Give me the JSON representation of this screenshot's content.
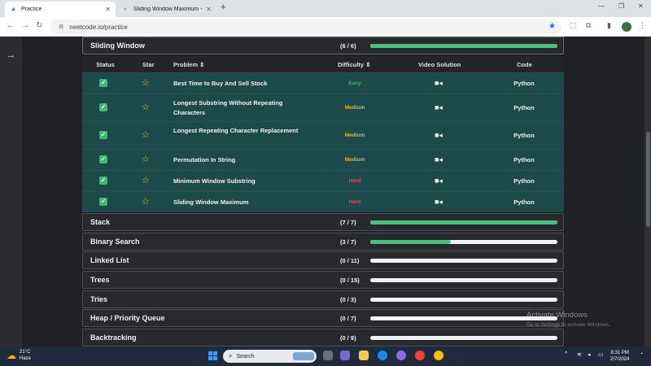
{
  "browser": {
    "tabs": [
      {
        "title": "Practice",
        "favicon": "neetcode-icon",
        "active": true
      },
      {
        "title": "Sliding Window Maximum - Le",
        "favicon": "leetcode-icon",
        "active": false
      }
    ],
    "url": "neetcode.io/practice"
  },
  "table": {
    "headers": {
      "status": "Status",
      "star": "Star",
      "problem": "Problem",
      "difficulty": "Difficulty",
      "video": "Video Solution",
      "code": "Code"
    },
    "difficulty_colors": {
      "Easy": "#3dba70",
      "Medium": "#f2b51d",
      "Hard": "#e04a5a"
    }
  },
  "sections": [
    {
      "name": "Sliding Window",
      "count": "(6 / 6)",
      "progress": 1.0
    },
    {
      "name": "Stack",
      "count": "(7 / 7)",
      "progress": 1.0
    },
    {
      "name": "Binary Search",
      "count": "(3 / 7)",
      "progress": 0.4286
    },
    {
      "name": "Linked List",
      "count": "(0 / 11)",
      "progress": 0
    },
    {
      "name": "Trees",
      "count": "(0 / 15)",
      "progress": 0
    },
    {
      "name": "Tries",
      "count": "(0 / 3)",
      "progress": 0
    },
    {
      "name": "Heap / Priority Queue",
      "count": "(0 / 7)",
      "progress": 0
    },
    {
      "name": "Backtracking",
      "count": "(0 / 9)",
      "progress": 0
    }
  ],
  "problems": [
    {
      "name": "Best Time to Buy And Sell Stock",
      "difficulty": "Easy",
      "code": "Python",
      "completed": true
    },
    {
      "name": "Longest Substring Without Repeating Characters",
      "difficulty": "Medium",
      "code": "Python",
      "completed": true
    },
    {
      "name": "Longest Repeating Character Replacement",
      "difficulty": "Medium",
      "code": "Python",
      "completed": true
    },
    {
      "name": "Permutation In String",
      "difficulty": "Medium",
      "code": "Python",
      "completed": true
    },
    {
      "name": "Minimum Window Substring",
      "difficulty": "Hard",
      "code": "Python",
      "completed": true
    },
    {
      "name": "Sliding Window Maximum",
      "difficulty": "Hard",
      "code": "Python",
      "completed": true
    }
  ],
  "watermark": {
    "title": "Activate Windows",
    "subtitle": "Go to Settings to activate Windows."
  },
  "taskbar": {
    "weather_temp": "21°C",
    "weather_desc": "Haze",
    "search_label": "Search",
    "time": "8:31 PM",
    "date": "2/7/2024"
  },
  "colors": {
    "accent_progress": "#48c27b",
    "row_bg": "#1c4a4a",
    "star": "#e6c13a"
  }
}
